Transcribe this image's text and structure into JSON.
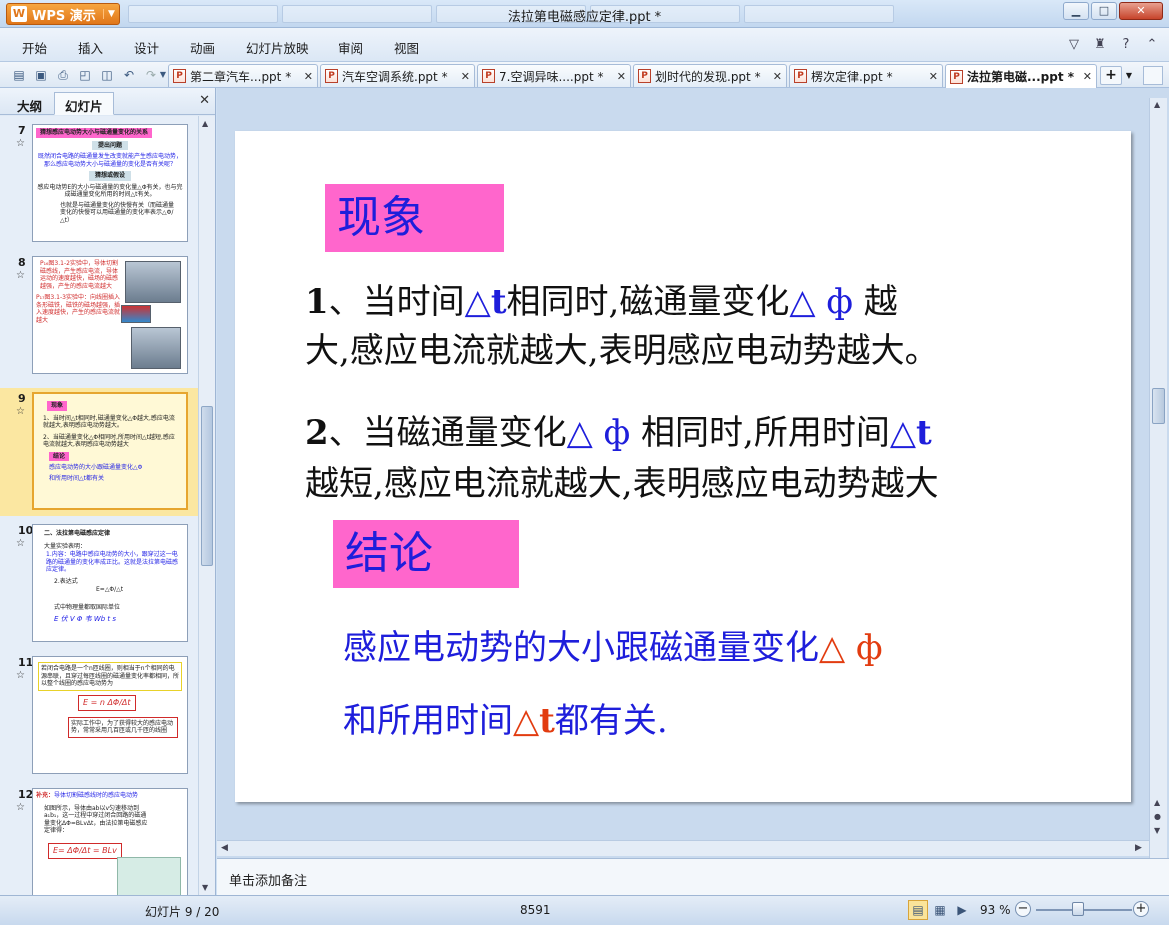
{
  "app": {
    "brand": "WPS 演示",
    "window_title": "法拉第电磁感应定律.ppt *"
  },
  "menu": [
    "开始",
    "插入",
    "设计",
    "动画",
    "幻灯片放映",
    "审阅",
    "视图"
  ],
  "doc_tabs": [
    {
      "label": "第二章汽车...ppt *",
      "active": false
    },
    {
      "label": "汽车空调系统.ppt *",
      "active": false
    },
    {
      "label": "7.空调异味....ppt *",
      "active": false
    },
    {
      "label": "划时代的发现.ppt *",
      "active": false
    },
    {
      "label": "楞次定律.ppt *",
      "active": false
    },
    {
      "label": "法拉第电磁...ppt *",
      "active": true
    }
  ],
  "left_panel": {
    "tabs": [
      "大纲",
      "幻灯片"
    ],
    "active_tab": "幻灯片",
    "thumbnails": [
      {
        "num": "7",
        "selected": false
      },
      {
        "num": "8",
        "selected": false
      },
      {
        "num": "9",
        "selected": true
      },
      {
        "num": "10",
        "selected": false
      },
      {
        "num": "11",
        "selected": false
      },
      {
        "num": "12",
        "selected": false
      }
    ],
    "t7": {
      "title": "猜想感应电动势大小与磁通量变化的关系",
      "pill1": "提出问题",
      "body1": "既然闭合电路的磁通量发生改变就能产生感应电动势，那么感应电动势大小与磁通量的变化是否有关呢？",
      "pill2": "猜想或假设",
      "body2": "感应电动势E的大小与磁通量的变化量△Φ有关，也与完成磁通量变化所用的时间△t有关。",
      "body3": "也就是与磁通量变化的快慢有关（而磁通量变化的快慢可以用磁通量的变化率表示△Φ/△t）"
    },
    "t8": {
      "text1": "P₁₆图3.1-2实验中，导体切割磁感线，产生感应电流，导体运动的速度越快，磁场的磁感越强，产生的感应电流越大",
      "text2": "P₁₇图3.1-3实验中：向线圈插入条形磁铁，磁铁的磁场越强，插入速度越快，产生的感应电流就越大"
    },
    "t9": {
      "badge1": "现象",
      "l1": "1、当时间△t相同时,磁通量变化△Φ越大,感应电流就越大,表明感应电动势越大。",
      "l2": "2、当磁通量变化△Φ相同时,所用时间△t越短,感应电流就越大,表明感应电动势越大",
      "badge2": "结论",
      "l3": "感应电动势的大小跟磁通量变化△Φ",
      "l4": "和所用时间△t都有关"
    },
    "t10": {
      "title": "二、法拉第电磁感应定律",
      "l1": "大量实验表明：",
      "l2": "1.内容：电路中感应电动势的大小，跟穿过这一电路的磁通量的变化率成正比。这就是法拉第电磁感应定律。",
      "l3": "2.表达式",
      "l4": "E=△Φ/△t",
      "l5": "式中物理量都取国际单位",
      "l6": "E 伏 V    Φ 韦 Wb    t    s"
    },
    "t11": {
      "box1": "若闭合电路是一个n匝线圈，则相当于n个相同的电源串联，且穿过每匝线圈的磁通量变化率都相同，所以整个线圈的感应电动势为",
      "formula": "E = n ΔΦ/Δt",
      "box2": "实际工作中，为了获得较大的感应电动势，常常采用几百匝或几千匝的线圈"
    },
    "t12": {
      "label": "补充：",
      "title": "导体切割磁感线时的感应电动势",
      "body": "如图所示，导体由ab以v匀速移动到a₁b₁，这一过程中穿过闭合回路的磁通量变化ΔΦ=BLvΔt，由法拉第电磁感应定律得：",
      "formula": "E= ΔΦ/Δt = BLv"
    }
  },
  "slide": {
    "badge1": "现象",
    "line1a_prefix": "1",
    "line1a_text": "、当时间",
    "line1a_delta": "△",
    "line1a_t": "t",
    "line1a_mid": "相同时,磁通量变化",
    "line1a_phi": "△ ф",
    "line1a_end": " 越",
    "line1b": "大,感应电流就越大,表明感应电动势越大。",
    "line2a_prefix": "2",
    "line2a_text": "、当磁通量变化",
    "line2a_phi": "△ ф",
    "line2a_mid": " 相同时,所用时间",
    "line2a_delta": "△",
    "line2a_t": "t",
    "line2b": "越短,感应电流就越大,表明感应电动势越大",
    "badge2": "结论",
    "line3_text": "感应电动势的大小跟磁通量变化",
    "line3_phi": "△ ф",
    "line4_text": "和所用时间",
    "line4_delta": "△",
    "line4_t": "t",
    "line4_end": "都有关."
  },
  "notes_placeholder": "单击添加备注",
  "status": {
    "slide_info": "幻灯片 9 / 20",
    "code": "8591",
    "zoom": "93 %"
  },
  "colors": {
    "badge": "#ff66cc",
    "blue_text": "#1e1edb",
    "red_text": "#e23c10"
  }
}
